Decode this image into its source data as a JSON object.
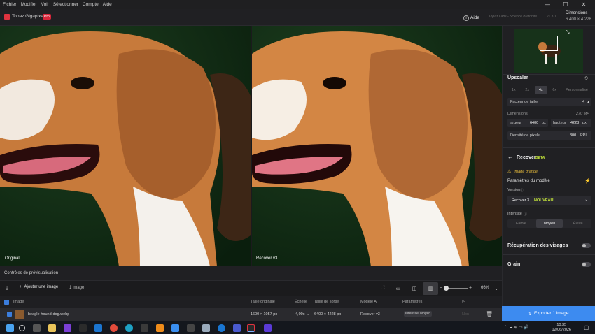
{
  "menu": [
    "Fichier",
    "Modifier",
    "Voir",
    "Sélectionner",
    "Compte",
    "Aide"
  ],
  "window_controls": [
    "—",
    "☐",
    "✕"
  ],
  "app": {
    "title": "Topaz Gigapixel",
    "badge": "Pro",
    "help_label": "Aide",
    "company": "Topaz Labs - Science Buttonite",
    "version": "v1.3.1",
    "dimensions_title": "Dimensions",
    "dimensions_value": "6.400 × 4.228"
  },
  "preview": {
    "left_label": "Original",
    "right_label": "Recover v3"
  },
  "controls": {
    "section_label": "Contrôles de prévisualisation",
    "add_image_label": "Ajouter une image",
    "image_count": "1 image",
    "zoom": "66%"
  },
  "table": {
    "headers": [
      "Image",
      "Taille originale",
      "Échelle",
      "Taille de sortie",
      "Modèle AI",
      "Paramètres"
    ],
    "row": {
      "filename": "beagle-hound-dog.webp",
      "original_size": "1600 × 1057 px",
      "scale": "4,00x →",
      "output_size": "6400 × 4228 px",
      "model": "Recover v3",
      "param_name": "Intensité",
      "param_value": "Moyen",
      "status": "Non"
    }
  },
  "panel": {
    "upscaler_title": "Upscaler",
    "scale_options": [
      "1x",
      "2x",
      "4x",
      "6x",
      "Personnalisé"
    ],
    "scale_selected": "4x",
    "size_factor_label": "Facteur de taille",
    "size_factor_value": "4",
    "dimensions_label": "Dimensions",
    "dimensions_mp": "270 MP",
    "width_label": "largeur",
    "width_value": "6400",
    "width_unit": "px",
    "height_label": "hauteur",
    "height_value": "4228",
    "height_unit": "px",
    "density_label": "Densité de pixels",
    "density_value": "300",
    "density_unit": "PPI",
    "recover_title": "Recover",
    "recover_badge": "BETA",
    "warning": "Image grande",
    "model_params_label": "Paramètres du modèle",
    "version_label": "Version",
    "version_value": "Recover 3",
    "version_badge": "NOUVEAU",
    "intensity_label": "Intensité",
    "intensity_options": [
      "Faible",
      "Moyen",
      "Élevé"
    ],
    "intensity_selected": "Moyen",
    "face_recovery_label": "Récupération des visages",
    "grain_label": "Grain",
    "export_label": "Exporter 1 image"
  },
  "taskbar": {
    "time": "10:35",
    "date": "12/06/2026"
  },
  "colors": {
    "accent": "#3d8bf0",
    "brand_red": "#e0333f",
    "warning_yellow": "#e3b83b",
    "new_badge": "#c5e63a"
  }
}
